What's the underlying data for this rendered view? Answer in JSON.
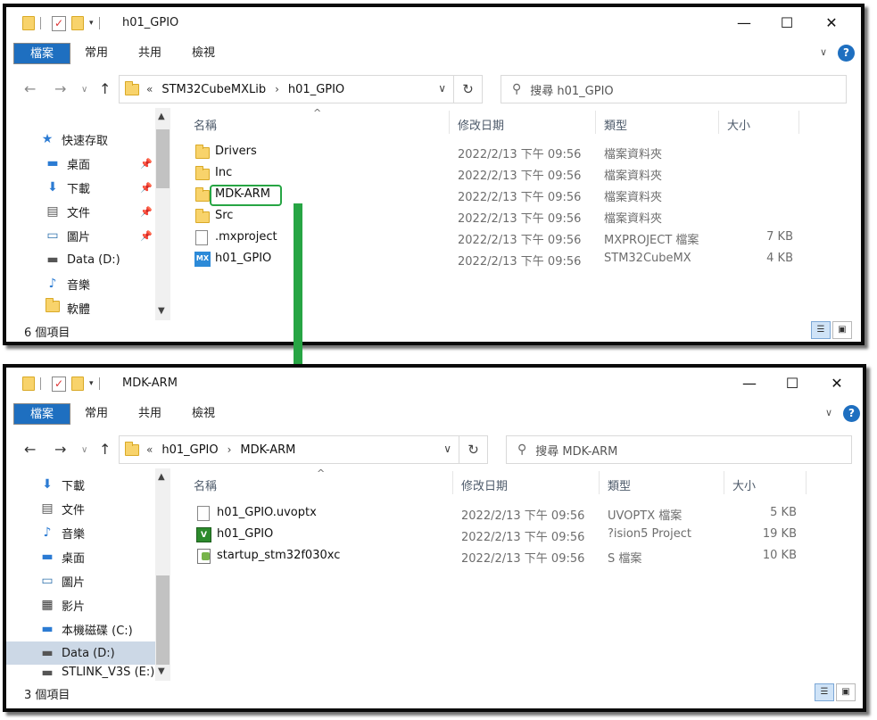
{
  "window1": {
    "title": "h01_GPIO",
    "ribbon_tabs": [
      "檔案",
      "常用",
      "共用",
      "檢視"
    ],
    "address_parts": [
      "«",
      "STM32CubeMXLib",
      "›",
      "h01_GPIO"
    ],
    "search_placeholder": "搜尋 h01_GPIO",
    "nav_items": [
      {
        "label": "快速存取",
        "icon": "star-icon"
      },
      {
        "label": "桌面",
        "icon": "desktop-icon"
      },
      {
        "label": "下載",
        "icon": "download-icon"
      },
      {
        "label": "文件",
        "icon": "document-icon"
      },
      {
        "label": "圖片",
        "icon": "picture-icon"
      },
      {
        "label": "Data (D:)",
        "icon": "drive-icon"
      },
      {
        "label": "音樂",
        "icon": "music-icon"
      },
      {
        "label": "軟體",
        "icon": "folder-icon"
      }
    ],
    "columns": [
      "名稱",
      "修改日期",
      "類型",
      "大小"
    ],
    "files": [
      {
        "name": "Drivers",
        "date": "2022/2/13 下午 09:56",
        "type": "檔案資料夾",
        "size": "",
        "icon": "folder-icon"
      },
      {
        "name": "Inc",
        "date": "2022/2/13 下午 09:56",
        "type": "檔案資料夾",
        "size": "",
        "icon": "folder-icon"
      },
      {
        "name": "MDK-ARM",
        "date": "2022/2/13 下午 09:56",
        "type": "檔案資料夾",
        "size": "",
        "icon": "folder-icon"
      },
      {
        "name": "Src",
        "date": "2022/2/13 下午 09:56",
        "type": "檔案資料夾",
        "size": "",
        "icon": "folder-icon"
      },
      {
        "name": ".mxproject",
        "date": "2022/2/13 下午 09:56",
        "type": "MXPROJECT 檔案",
        "size": "7 KB",
        "icon": "file-icon"
      },
      {
        "name": "h01_GPIO",
        "date": "2022/2/13 下午 09:56",
        "type": "STM32CubeMX",
        "size": "4 KB",
        "icon": "stm32cubemx-icon"
      }
    ],
    "status": "6 個項目"
  },
  "window2": {
    "title": "MDK-ARM",
    "ribbon_tabs": [
      "檔案",
      "常用",
      "共用",
      "檢視"
    ],
    "address_parts": [
      "«",
      "h01_GPIO",
      "›",
      "MDK-ARM"
    ],
    "search_placeholder": "搜尋 MDK-ARM",
    "nav_items": [
      {
        "label": "下載",
        "icon": "download-icon"
      },
      {
        "label": "文件",
        "icon": "document-icon"
      },
      {
        "label": "音樂",
        "icon": "music-icon"
      },
      {
        "label": "桌面",
        "icon": "desktop-icon"
      },
      {
        "label": "圖片",
        "icon": "picture-icon"
      },
      {
        "label": "影片",
        "icon": "video-icon"
      },
      {
        "label": "本機磁碟 (C:)",
        "icon": "drive-icon"
      },
      {
        "label": "Data (D:)",
        "icon": "drive-icon"
      },
      {
        "label": "STLINK_V3S (E:)",
        "icon": "drive-icon"
      }
    ],
    "columns": [
      "名稱",
      "修改日期",
      "類型",
      "大小"
    ],
    "files": [
      {
        "name": "h01_GPIO.uvoptx",
        "date": "2022/2/13 下午 09:56",
        "type": "UVOPTX 檔案",
        "size": "5 KB",
        "icon": "file-icon"
      },
      {
        "name": "h01_GPIO",
        "date": "2022/2/13 下午 09:56",
        "type": "?ision5 Project",
        "size": "19 KB",
        "icon": "keil-project-icon"
      },
      {
        "name": "startup_stm32f030xc",
        "date": "2022/2/13 下午 09:56",
        "type": "S 檔案",
        "size": "10 KB",
        "icon": "assembly-file-icon"
      }
    ],
    "status": "3 個項目"
  },
  "colors": {
    "ribbon_file_tab": "#1e6fc0",
    "highlight": "#27a544",
    "selected_nav": "#ccd8e6"
  }
}
